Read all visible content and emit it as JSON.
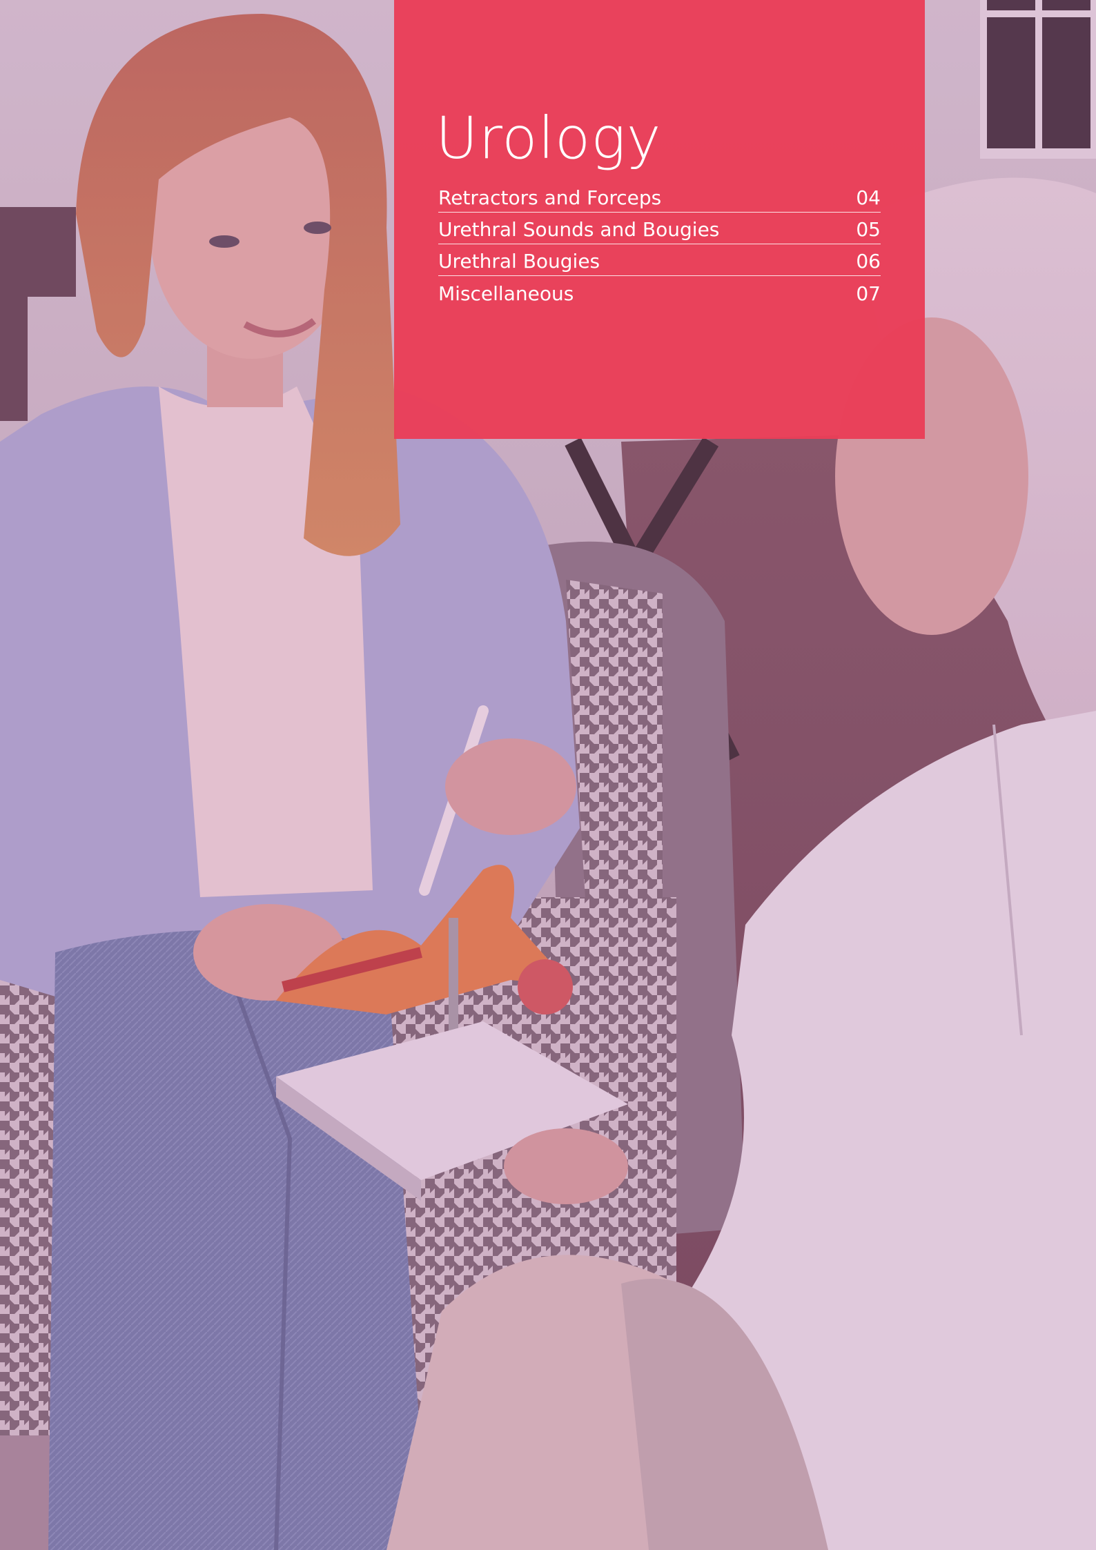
{
  "panel": {
    "title": "Urology",
    "accent_color": "#E93E58"
  },
  "toc": [
    {
      "label": "Retractors and Forceps",
      "page": "04"
    },
    {
      "label": "Urethral Sounds and Bougies",
      "page": "05"
    },
    {
      "label": "Urethral Bougies",
      "page": "06"
    },
    {
      "label": "Miscellaneous",
      "page": "07"
    }
  ],
  "photo": {
    "description_icon": "photo-consultation"
  }
}
